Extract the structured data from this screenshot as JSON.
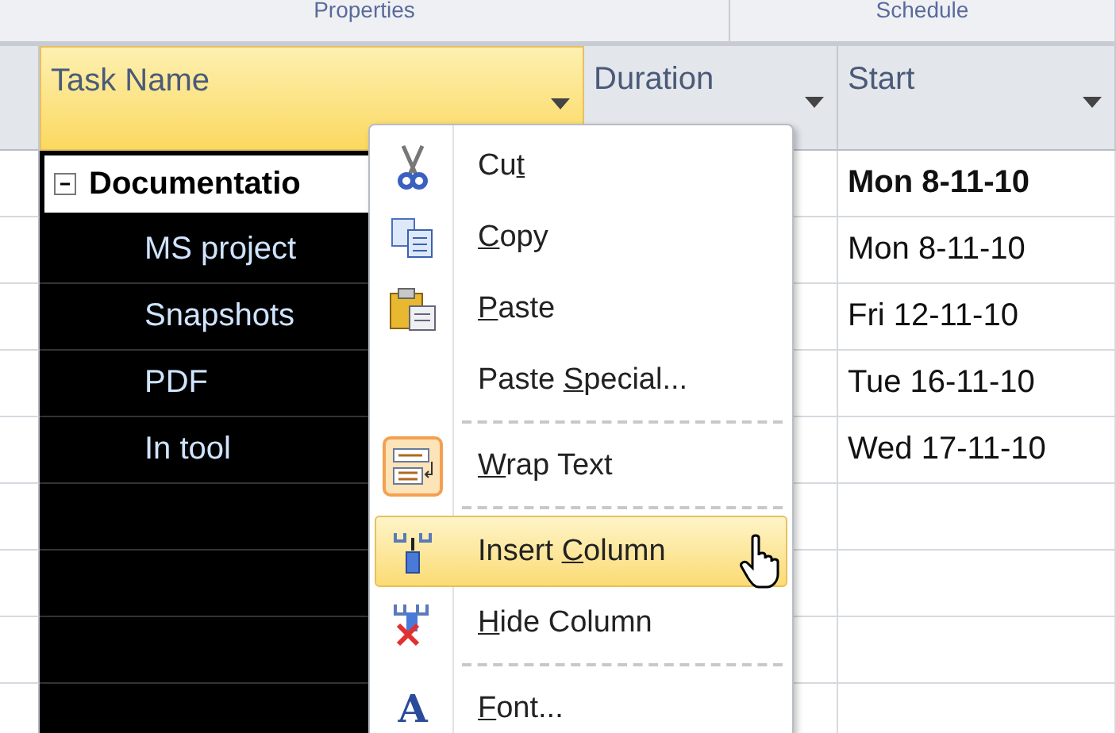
{
  "groups": [
    {
      "label": "Properties"
    },
    {
      "label": "Schedule"
    }
  ],
  "columns": [
    {
      "label": "Task Name",
      "selected": true
    },
    {
      "label": "Duration",
      "selected": false
    },
    {
      "label": "Start",
      "selected": false
    }
  ],
  "tasks": [
    {
      "name": "Documentatio",
      "start": "Mon 8-11-10",
      "expanded": true,
      "children": [
        {
          "name": "MS project",
          "start": "Mon 8-11-10"
        },
        {
          "name": "Snapshots",
          "start": "Fri 12-11-10"
        },
        {
          "name": "PDF",
          "start": "Tue 16-11-10"
        },
        {
          "name": "In tool",
          "start": "Wed 17-11-10"
        }
      ]
    }
  ],
  "context_menu": [
    {
      "kind": "cut",
      "before": "Cu",
      "access_key": "t",
      "selected": false
    },
    {
      "kind": "copy",
      "access_key": "C",
      "after": "opy",
      "selected": false
    },
    {
      "kind": "paste",
      "access_key": "P",
      "after": "aste",
      "selected": false
    },
    {
      "kind": "plain",
      "before": "Paste ",
      "access_key": "S",
      "after": "pecial...",
      "selected": false
    },
    {
      "kind": "separator"
    },
    {
      "kind": "wrap",
      "access_key": "W",
      "after": "rap Text",
      "selected": false,
      "checked": true
    },
    {
      "kind": "separator"
    },
    {
      "kind": "insert",
      "before": "Insert ",
      "access_key": "C",
      "after": "olumn",
      "selected": true
    },
    {
      "kind": "hide",
      "access_key": "H",
      "after": "ide Column",
      "selected": false
    },
    {
      "kind": "separator"
    },
    {
      "kind": "font",
      "icon_text": "A",
      "access_key": "F",
      "after": "ont...",
      "selected": false
    }
  ]
}
